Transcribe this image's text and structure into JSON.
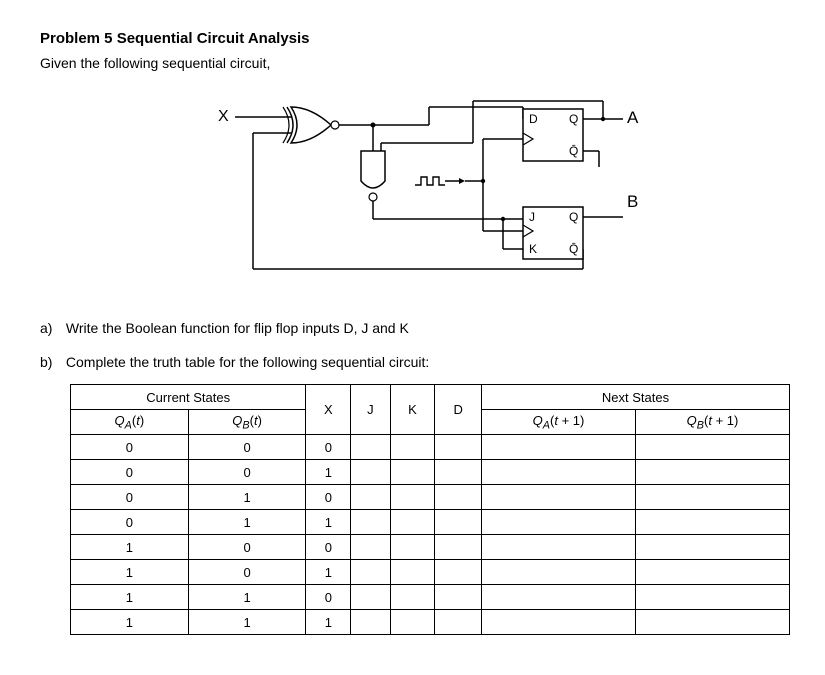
{
  "title": "Problem 5 Sequential Circuit Analysis",
  "given": "Given the following sequential circuit,",
  "diagram": {
    "input_X": "X",
    "output_A": "A",
    "output_B": "B",
    "ff1": {
      "D": "D",
      "Q": "Q",
      "Qbar": "Q̄"
    },
    "ff2": {
      "J": "J",
      "Q": "Q",
      "K": "K",
      "Qbar": "Q̄"
    },
    "clock": "⎍⎍"
  },
  "qa": {
    "letter": "a)",
    "text": "Write the Boolean function for flip flop inputs D, J and K"
  },
  "qb": {
    "letter": "b)",
    "text": "Complete the truth table for the following sequential circuit:"
  },
  "table": {
    "groups": {
      "current": "Current States",
      "next": "Next States"
    },
    "headers": {
      "QA_t": "Q_A(t)",
      "QB_t": "Q_B(t)",
      "X": "X",
      "J": "J",
      "K": "K",
      "D": "D",
      "QA_t1": "Q_A(t + 1)",
      "QB_t1": "Q_B(t + 1)"
    },
    "rows": [
      {
        "QA": "0",
        "QB": "0",
        "X": "0",
        "J": "",
        "K": "",
        "D": "",
        "QA1": "",
        "QB1": ""
      },
      {
        "QA": "0",
        "QB": "0",
        "X": "1",
        "J": "",
        "K": "",
        "D": "",
        "QA1": "",
        "QB1": ""
      },
      {
        "QA": "0",
        "QB": "1",
        "X": "0",
        "J": "",
        "K": "",
        "D": "",
        "QA1": "",
        "QB1": ""
      },
      {
        "QA": "0",
        "QB": "1",
        "X": "1",
        "J": "",
        "K": "",
        "D": "",
        "QA1": "",
        "QB1": ""
      },
      {
        "QA": "1",
        "QB": "0",
        "X": "0",
        "J": "",
        "K": "",
        "D": "",
        "QA1": "",
        "QB1": ""
      },
      {
        "QA": "1",
        "QB": "0",
        "X": "1",
        "J": "",
        "K": "",
        "D": "",
        "QA1": "",
        "QB1": ""
      },
      {
        "QA": "1",
        "QB": "1",
        "X": "0",
        "J": "",
        "K": "",
        "D": "",
        "QA1": "",
        "QB1": ""
      },
      {
        "QA": "1",
        "QB": "1",
        "X": "1",
        "J": "",
        "K": "",
        "D": "",
        "QA1": "",
        "QB1": ""
      }
    ]
  }
}
